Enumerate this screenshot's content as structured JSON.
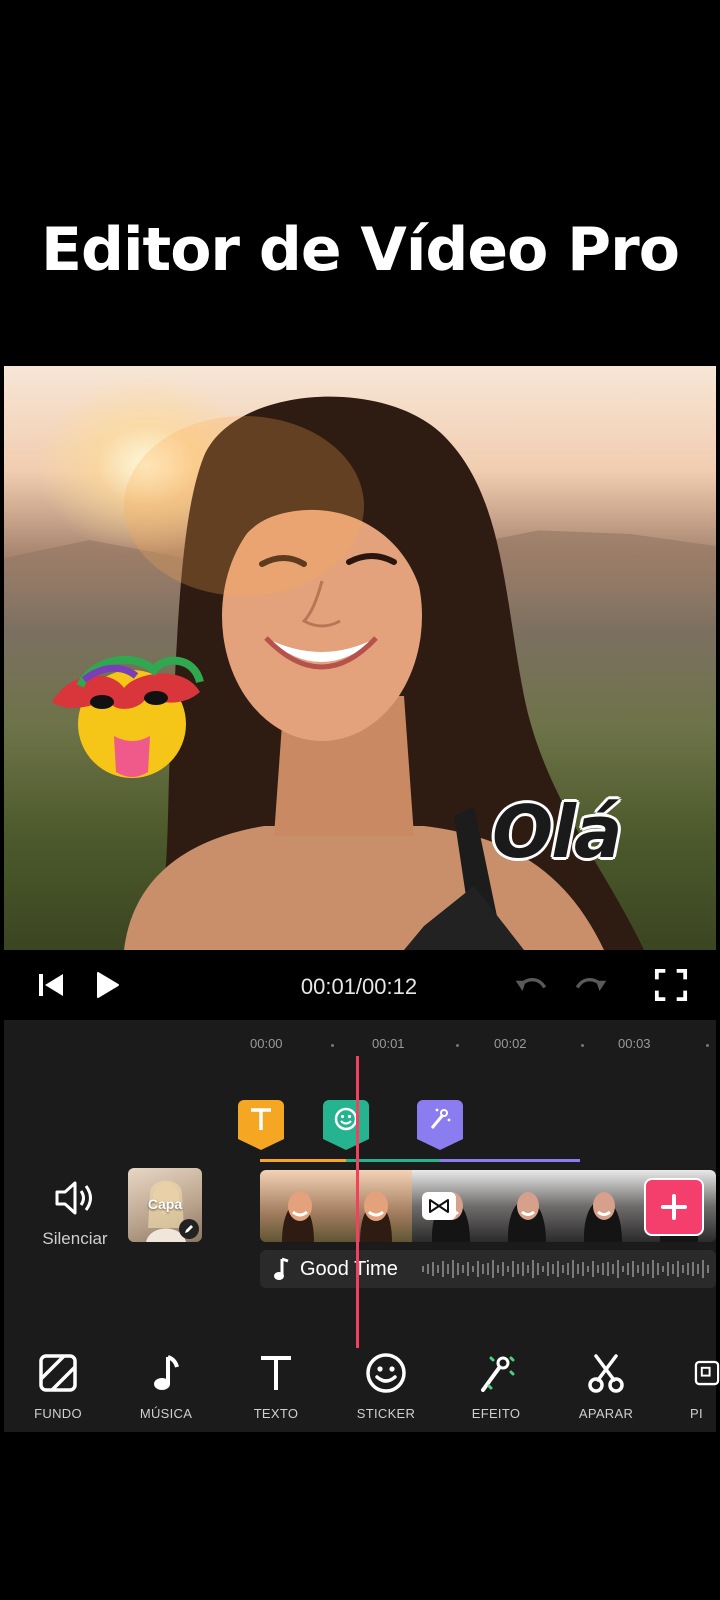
{
  "headline": "Editor de Vídeo Pro",
  "preview": {
    "overlay_text": "Olá",
    "sticker": "carnival-mask-emoji-sticker"
  },
  "playback": {
    "timecode": "00:01/00:12"
  },
  "timeline": {
    "ticks": [
      "00:00",
      "00:01",
      "00:02",
      "00:03"
    ],
    "markers": [
      {
        "icon": "text-icon",
        "color": "#f5a623"
      },
      {
        "icon": "sticker-icon",
        "color": "#26b38f"
      },
      {
        "icon": "effect-icon",
        "color": "#8b7cf0"
      }
    ],
    "mute_label": "Silenciar",
    "cover_label": "Capa",
    "audio_track": "Good Time",
    "playhead_color": "#f0415f",
    "add_button_color": "#f43f6c"
  },
  "toolbar": {
    "items": [
      {
        "label": "FUNDO",
        "icon": "background-icon"
      },
      {
        "label": "MÚSICA",
        "icon": "music-note-icon"
      },
      {
        "label": "TEXTO",
        "icon": "text-icon"
      },
      {
        "label": "STICKER",
        "icon": "smiley-icon"
      },
      {
        "label": "EFEITO",
        "icon": "magic-wand-icon"
      },
      {
        "label": "APARAR",
        "icon": "scissors-icon"
      },
      {
        "label": "PI",
        "icon": "pip-icon"
      }
    ]
  }
}
